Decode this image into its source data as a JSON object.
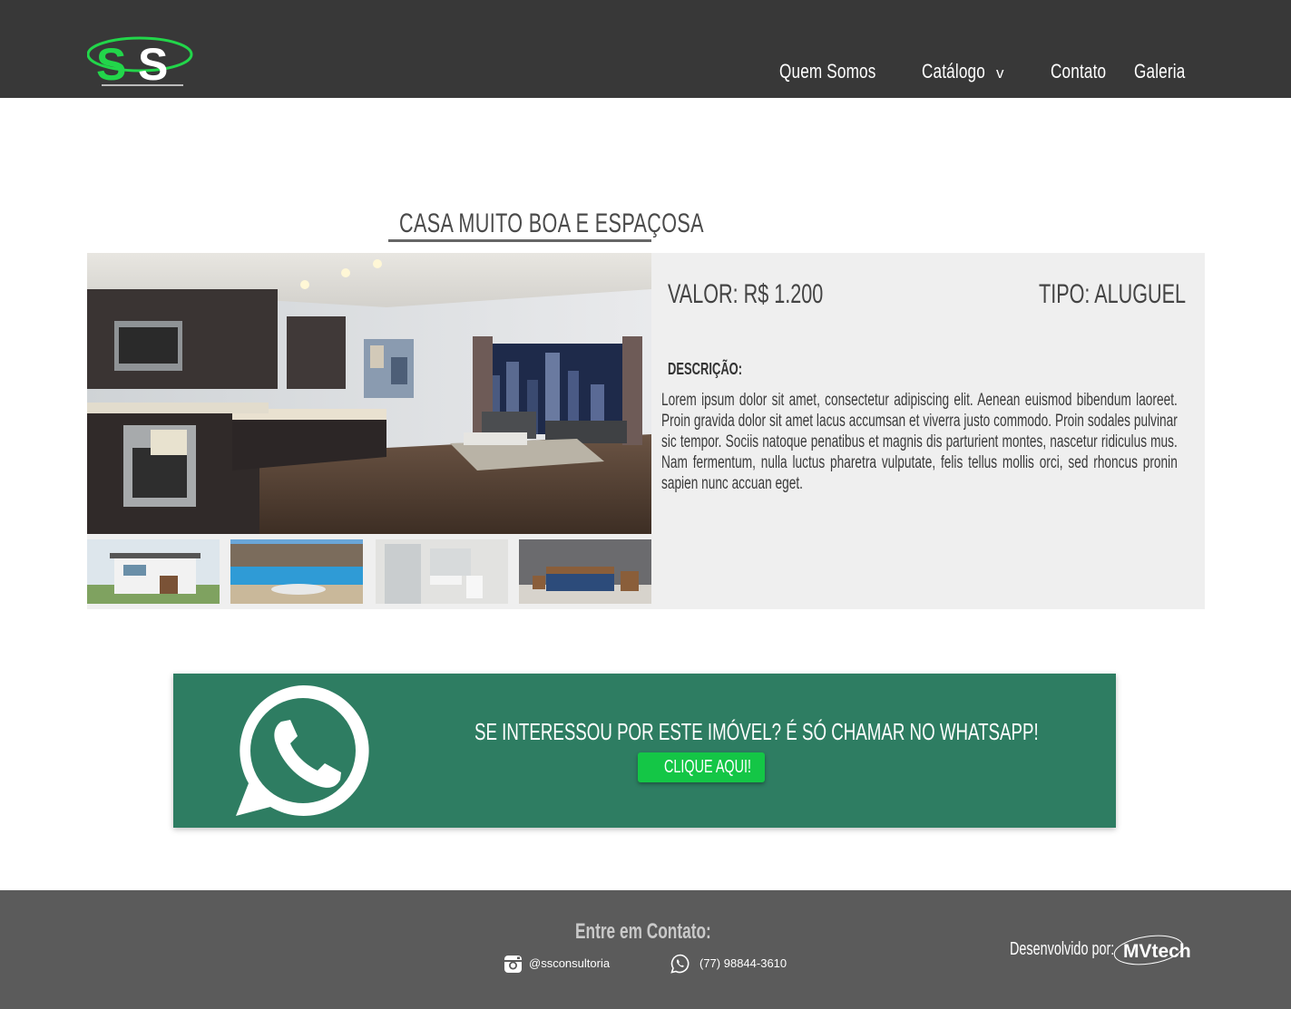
{
  "header": {
    "nav": {
      "quem_somos": "Quem Somos",
      "catalogo": "Catálogo",
      "catalogo_caret": "v",
      "contato": "Contato",
      "galeria": "Galeria"
    }
  },
  "property": {
    "title": "CASA MUITO BOA E ESPAÇOSA",
    "valor": "VALOR: R$ 1.200",
    "tipo": "TIPO: ALUGUEL",
    "description_label": "DESCRIÇÃO:",
    "description": "Lorem ipsum dolor sit amet, consectetur adipiscing elit. Aenean euismod bibendum laoreet. Proin gravida dolor sit amet lacus accumsan et viverra justo commodo. Proin sodales pulvinar sic tempor. Sociis natoque penatibus et magnis dis parturient montes, nascetur ridiculus mus. Nam fermentum, nulla luctus pharetra vulputate, felis tellus mollis orci, sed rhoncus pronin sapien nunc accuan eget."
  },
  "whatsapp_banner": {
    "text": "SE INTERESSOU POR ESTE IMÓVEL? É SÓ CHAMAR NO WHATSAPP!",
    "button": "CLIQUE AQUI!"
  },
  "footer": {
    "title": "Entre em Contato:",
    "instagram": "@ssconsultoria",
    "phone": "(77) 98844-3610",
    "developed_by": "Desenvolvido por:",
    "developer_brand": "MVtech"
  },
  "colors": {
    "header_bg": "#383838",
    "footer_bg": "#5b5b5b",
    "banner_green": "#2e7d62",
    "button_green": "#14c646",
    "logo_green": "#22d64a"
  }
}
